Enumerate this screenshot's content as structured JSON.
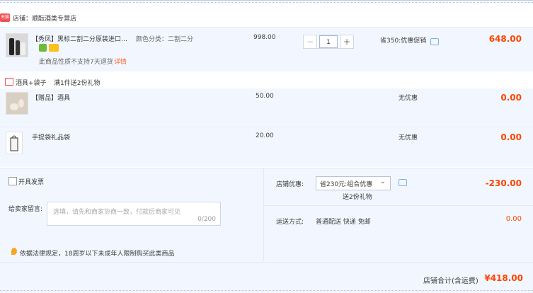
{
  "shop": {
    "badge": "天猫",
    "name": "店铺：顺酝酒类专营店"
  },
  "item1": {
    "title": "【秀凤】黑标二割二分原装进口…",
    "spec": "颜色分类：二割二分",
    "note": "此商品性质不支持7天退货",
    "note_link": "详情",
    "unit_price": "998.00",
    "qty": "1",
    "minus": "−",
    "plus": "+",
    "promo": "省350:优惠促销",
    "subtotal": "648.00"
  },
  "gift_line": {
    "label": "酒具+袋子",
    "rule": "满1件送2份礼物"
  },
  "item2": {
    "title": "【赠品】酒具",
    "unit_price": "50.00",
    "promo": "无优惠",
    "subtotal": "0.00"
  },
  "item3": {
    "title": "手提袋礼品袋",
    "unit_price": "20.00",
    "promo": "无优惠",
    "subtotal": "0.00"
  },
  "options": {
    "invoice": "开具发票",
    "message_label": "给卖家留言:",
    "message_placeholder": "选填，请先和商家协商一致，付款后商家可见",
    "message_count": "0/200",
    "legal_notice": "依据法律规定，18周岁以下未成年人限制购买此类商品"
  },
  "discount": {
    "label": "店铺优惠:",
    "selected": "省230元:组合优惠",
    "gift_note": "送2份礼物",
    "amount": "-230.00"
  },
  "shipping": {
    "label": "运送方式:",
    "value": "普通配送 快递 免邮",
    "amount": "0.00"
  },
  "total": {
    "label": "店铺合计(含运费)",
    "amount": "¥418.00"
  }
}
